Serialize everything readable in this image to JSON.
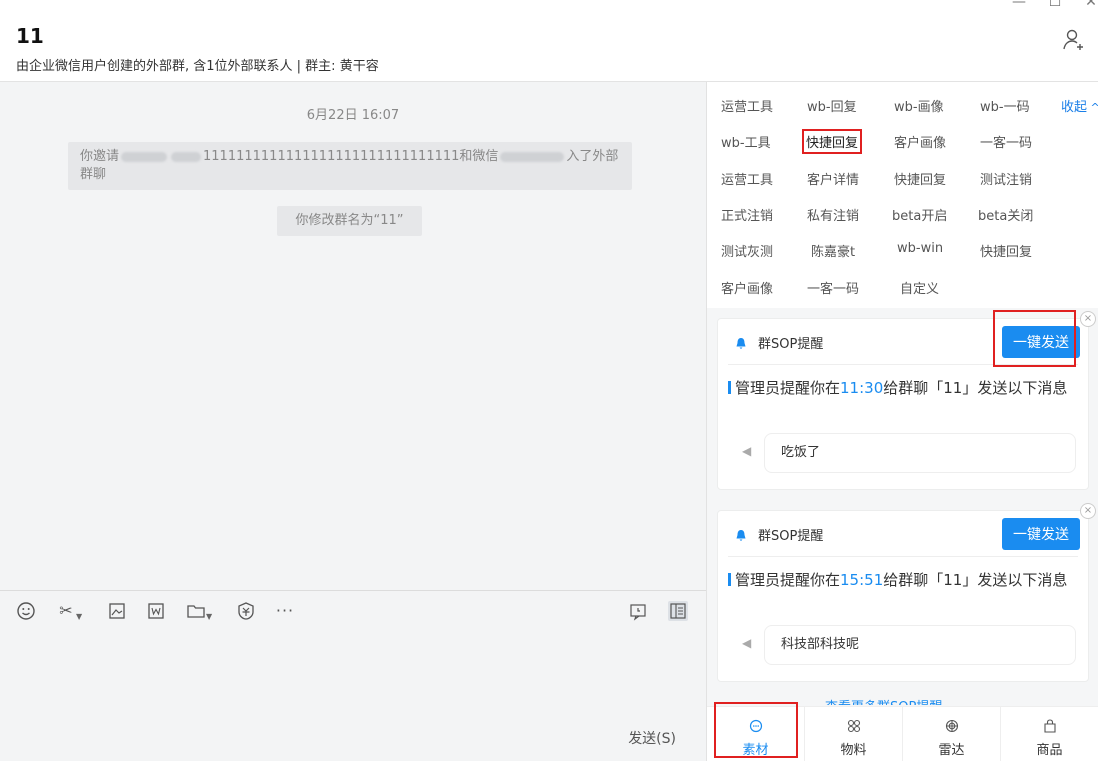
{
  "window": {
    "minimize": "—",
    "maximize": "☐",
    "close": "✕"
  },
  "header": {
    "title": "11",
    "subtitle": "由企业微信用户创建的外部群, 含1位外部联系人 | 群主: 黄干容"
  },
  "chat": {
    "time": "6月22日 16:07",
    "invite_pre": "你邀请",
    "invite_mid": "1111111111111111111111111111111和微信",
    "invite_post": "入了外部群聊",
    "rename": "你修改群名为“11”"
  },
  "composer": {
    "send_label": "发送(S)"
  },
  "tools": {
    "items": [
      "运营工具",
      "wb-回复",
      "wb-画像",
      "wb-一码",
      "收起",
      "wb-工具",
      "快捷回复",
      "客户画像",
      "一客一码",
      "运营工具",
      "客户详情",
      "快捷回复",
      "测试注销",
      "正式注销",
      "私有注销",
      "beta开启",
      "beta关闭",
      "测试灰测",
      "陈嘉豪t",
      "wb-win",
      "快捷回复",
      "客户画像",
      "一客一码",
      "自定义"
    ]
  },
  "cards": [
    {
      "title": "群SOP提醒",
      "send_all": "一键发送",
      "msg_pre": "管理员提醒你在",
      "time": "11:30",
      "msg_post": "给群聊「11」发送以下消息",
      "item": "吃饭了"
    },
    {
      "title": "群SOP提醒",
      "send_all": "一键发送",
      "msg_pre": "管理员提醒你在",
      "time": "15:51",
      "msg_post": "给群聊「11」发送以下消息",
      "item": "科技部科技呢"
    }
  ],
  "more_link": "查看更多群SOP提醒",
  "bottom_nav": [
    {
      "label": "素材",
      "icon": "chat-bubble-icon"
    },
    {
      "label": "物料",
      "icon": "grid-icon"
    },
    {
      "label": "雷达",
      "icon": "radar-icon"
    },
    {
      "label": "商品",
      "icon": "bag-icon"
    }
  ],
  "colors": {
    "accent": "#1a8cf0",
    "highlight": "#e02020"
  }
}
